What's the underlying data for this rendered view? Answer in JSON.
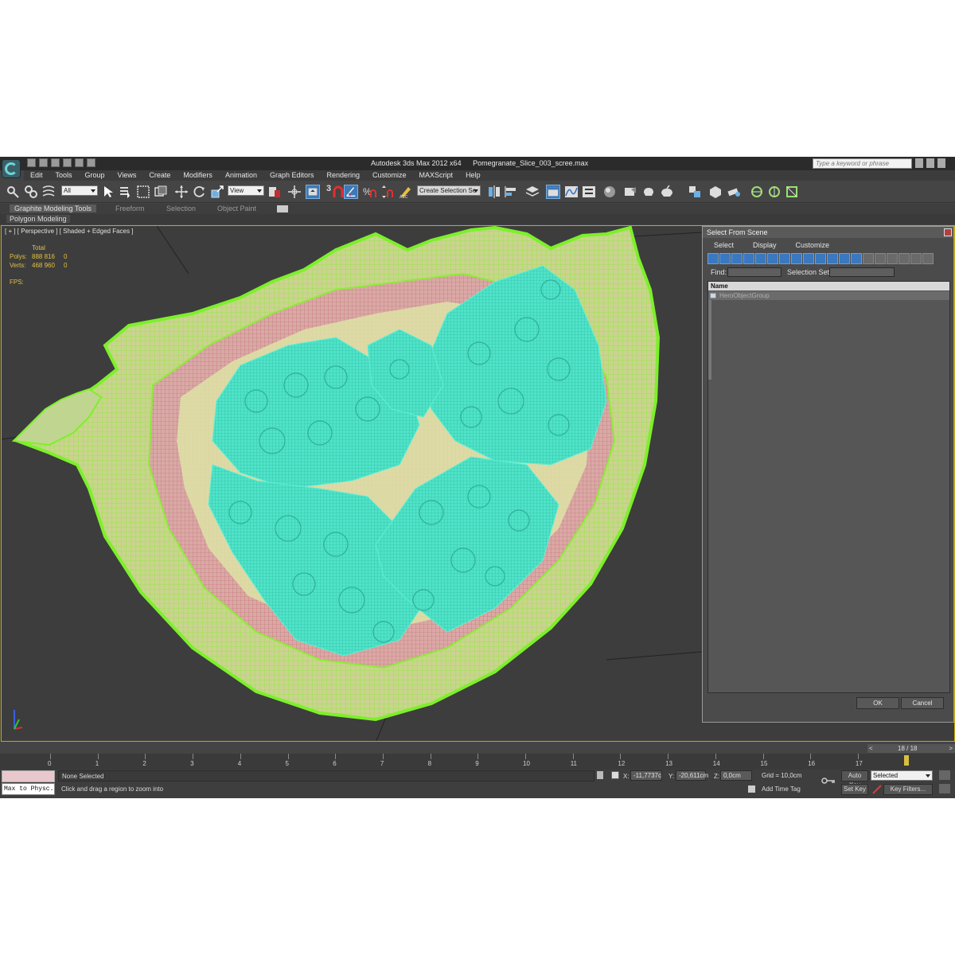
{
  "window": {
    "app_name": "Autodesk 3ds Max  2012 x64",
    "file_name": "Pomegranate_Slice_003_scree.max",
    "search_placeholder": "Type a keyword or phrase"
  },
  "menu": [
    "Edit",
    "Tools",
    "Group",
    "Views",
    "Create",
    "Modifiers",
    "Animation",
    "Graph Editors",
    "Rendering",
    "Customize",
    "MAXScript",
    "Help"
  ],
  "toolbar": {
    "selection_filter": "All",
    "reference_coord": "View",
    "snap_label": "3",
    "named_selection_set": "Create Selection Se"
  },
  "ribbon": {
    "tabs": [
      "Graphite Modeling Tools",
      "Freeform",
      "Selection",
      "Object Paint"
    ],
    "active_panel": "Polygon Modeling"
  },
  "viewport": {
    "label": "[ + ] [ Perspective ] [ Shaded + Edged Faces ]",
    "stats_header": "Total",
    "stats": [
      {
        "label": "Polys:",
        "value": "888 816",
        "sel": "0"
      },
      {
        "label": "Verts:",
        "value": "468 960",
        "sel": "0"
      }
    ],
    "fps_label": "FPS:",
    "colors": {
      "peel_wire": "#9cff2e",
      "seeds_wire": "#4fe3c8",
      "pulp": "#c27b82",
      "background": "#3d3d3d",
      "active_border": "#c9a800"
    }
  },
  "dialog": {
    "title": "Select From Scene",
    "menu": [
      "Select",
      "Display",
      "Customize"
    ],
    "find_label": "Find:",
    "selection_set_label": "Selection Set:",
    "column_name": "Name",
    "items": [
      "HeroObjectGroup"
    ],
    "ok_label": "OK",
    "cancel_label": "Cancel"
  },
  "timeline": {
    "current_frame_label": "18 / 18",
    "ticks": [
      "0",
      "1",
      "2",
      "3",
      "4",
      "5",
      "6",
      "7",
      "8",
      "9",
      "10",
      "11",
      "12",
      "13",
      "14",
      "15",
      "16",
      "17"
    ]
  },
  "status": {
    "maxscript_text": "Max to Physc.",
    "selection_text": "None Selected",
    "prompt_text": "Click and drag a region to zoom into",
    "x_label": "X:",
    "x_value": "-11,7737c",
    "y_label": "Y:",
    "y_value": "-20,611cm",
    "z_label": "Z:",
    "z_value": "0,0cm",
    "grid_text": "Grid = 10,0cm",
    "add_time_tag": "Add Time Tag",
    "auto_key": "Auto Key",
    "set_key": "Set Key",
    "key_mode": "Selected",
    "key_filters": "Key Filters..."
  }
}
